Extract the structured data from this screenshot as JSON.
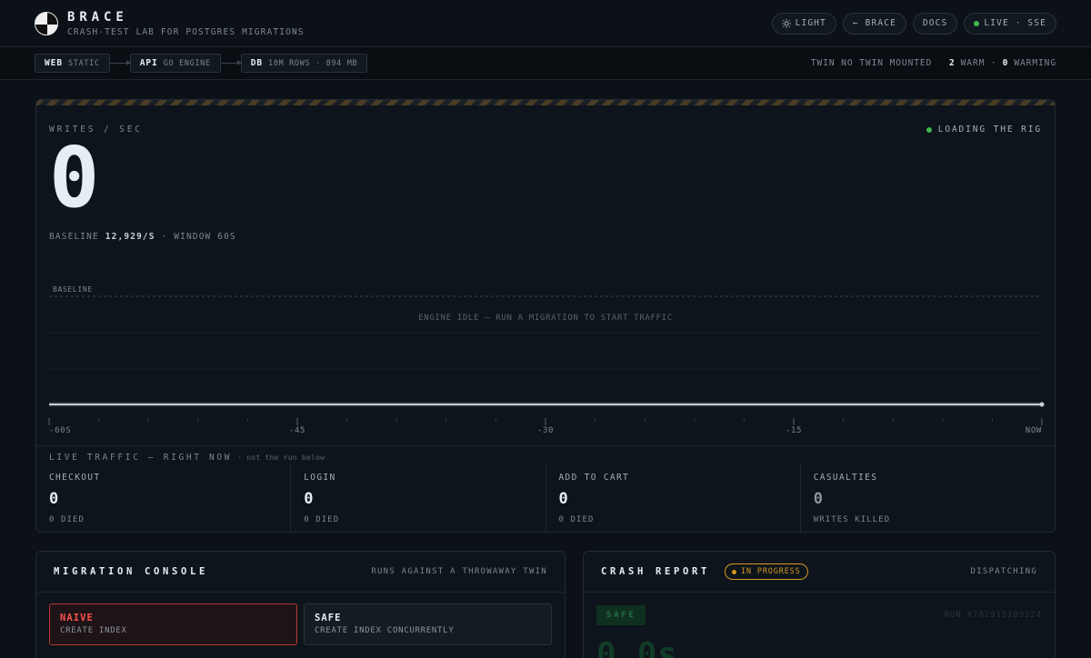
{
  "header": {
    "brand_title": "BRACE",
    "brand_subtitle": "CRASH-TEST LAB FOR POSTGRES MIGRATIONS",
    "actions": [
      {
        "label": "LIGHT",
        "icon": "sun-icon"
      },
      {
        "label": "← BRACE",
        "icon": ""
      },
      {
        "label": "DOCS",
        "icon": ""
      },
      {
        "label": "LIVE · SSE",
        "icon": "status-dot"
      }
    ]
  },
  "topology": {
    "nodes": [
      {
        "name": "WEB",
        "detail": "STATIC"
      },
      {
        "name": "API",
        "detail": "GO ENGINE"
      },
      {
        "name": "DB",
        "detail": "10M ROWS · 894 MB"
      }
    ],
    "twin_text": "TWIN NO TWIN MOUNTED",
    "warm_count": "2",
    "warm_label": "WARM ·",
    "warming_count": "0",
    "warming_label": "WARMING"
  },
  "writes": {
    "label": "WRITES / SEC",
    "value": "0",
    "status": "LOADING THE RIG",
    "baseline_prefix": "BASELINE",
    "baseline_value": "12,929/S",
    "window_text": "· WINDOW 60S"
  },
  "chart_data": {
    "type": "line",
    "baseline_label": "BASELINE",
    "idle_message": "ENGINE IDLE — RUN A MIGRATION TO START TRAFFIC",
    "x_ticks": [
      "-60S",
      "-45",
      "-30",
      "-15",
      "NOW"
    ],
    "x": [
      -60,
      0
    ],
    "values": [
      0,
      0
    ],
    "xlim": [
      -60,
      0
    ]
  },
  "traffic": {
    "title": "LIVE TRAFFIC — RIGHT NOW",
    "note": "· not the run below",
    "stats": [
      {
        "label": "CHECKOUT",
        "value": "0",
        "sub": "0 DIED"
      },
      {
        "label": "LOGIN",
        "value": "0",
        "sub": "0 DIED"
      },
      {
        "label": "ADD TO CART",
        "value": "0",
        "sub": "0 DIED"
      },
      {
        "label": "CASUALTIES",
        "value": "0",
        "sub": "WRITES KILLED"
      }
    ]
  },
  "console": {
    "title": "MIGRATION CONSOLE",
    "note": "RUNS AGAINST A THROWAWAY TWIN",
    "options": [
      {
        "name": "NAIVE",
        "desc": "CREATE INDEX"
      },
      {
        "name": "SAFE",
        "desc": "CREATE INDEX CONCURRENTLY"
      }
    ]
  },
  "crash": {
    "title": "CRASH REPORT",
    "badge": "IN PROGRESS",
    "status": "DISPATCHING",
    "tag": "SAFE",
    "run_id": "RUN R782915203124",
    "ghost_value": "0.0s"
  },
  "colors": {
    "accent_green": "#3fb950",
    "warning_amber": "#d29922",
    "danger_red": "#f85149"
  }
}
